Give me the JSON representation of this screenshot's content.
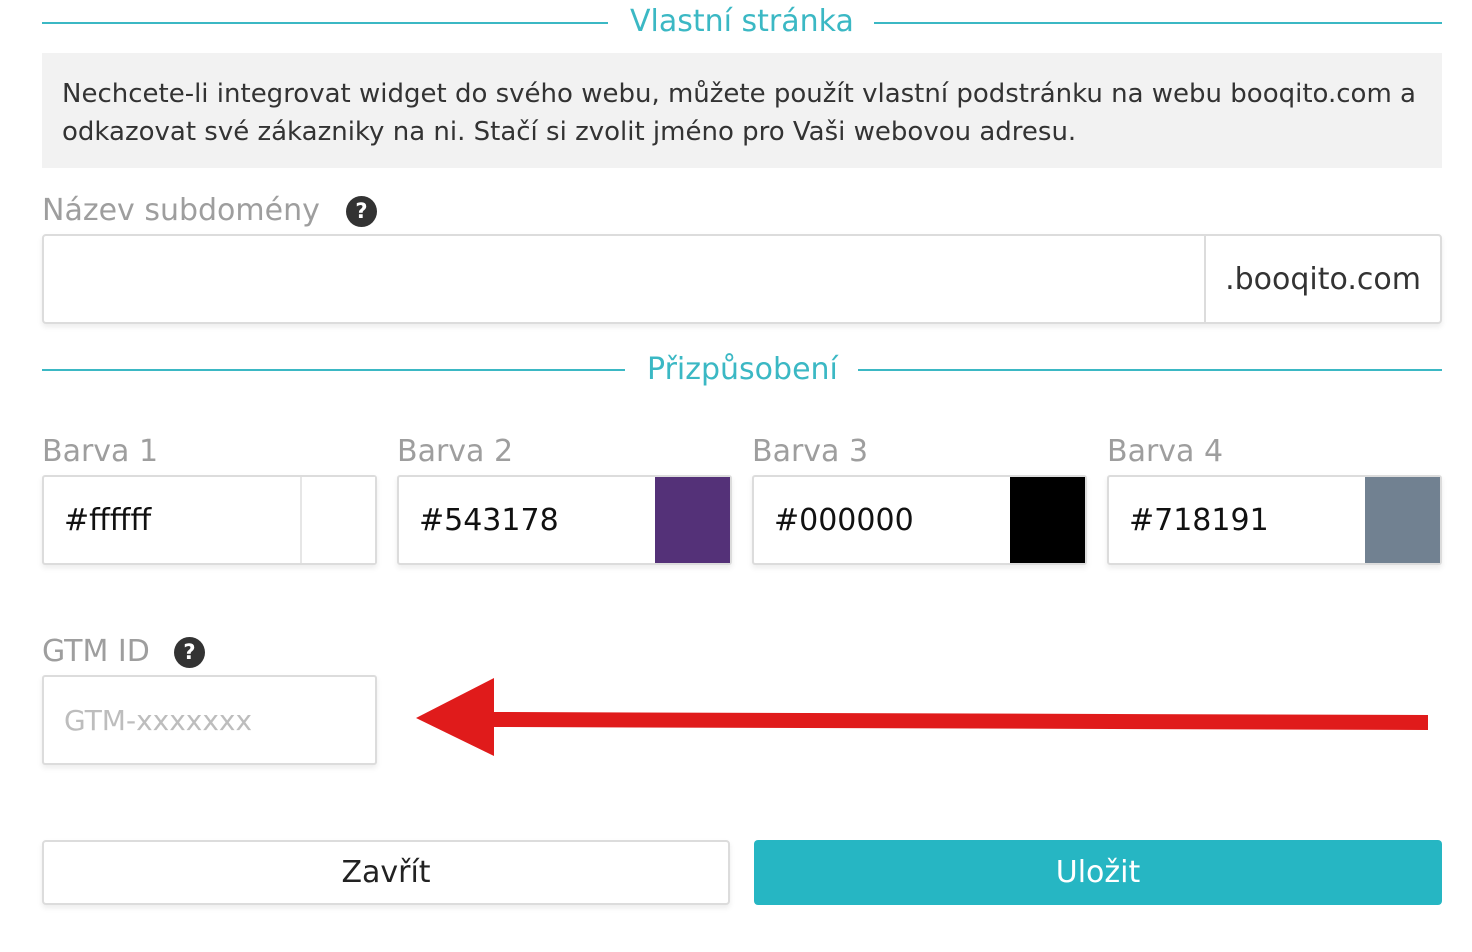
{
  "sections": {
    "custom_page_title": "Vlastní stránka",
    "customization_title": "Přizpůsobení"
  },
  "info": {
    "text": "Nechcete-li integrovat widget do svého webu, můžete použít vlastní podstránku na webu booqito.com a odkazovat své zákazniky na ni. Stačí si zvolit jméno pro Vaši webovou adresu."
  },
  "subdomain": {
    "label": "Název subdomény",
    "value": "",
    "suffix": ".booqito.com",
    "help": "?"
  },
  "colors": [
    {
      "label": "Barva 1",
      "value": "#ffffff",
      "swatch": "#ffffff"
    },
    {
      "label": "Barva 2",
      "value": "#543178",
      "swatch": "#543178"
    },
    {
      "label": "Barva 3",
      "value": "#000000",
      "swatch": "#000000"
    },
    {
      "label": "Barva 4",
      "value": "#718191",
      "swatch": "#718191"
    }
  ],
  "gtm": {
    "label": "GTM ID",
    "placeholder": "GTM-xxxxxxx",
    "value": "",
    "help": "?"
  },
  "buttons": {
    "close_label": "Zavřít",
    "save_label": "Uložit"
  },
  "annotation": {
    "arrow_color": "#e01b1b"
  }
}
